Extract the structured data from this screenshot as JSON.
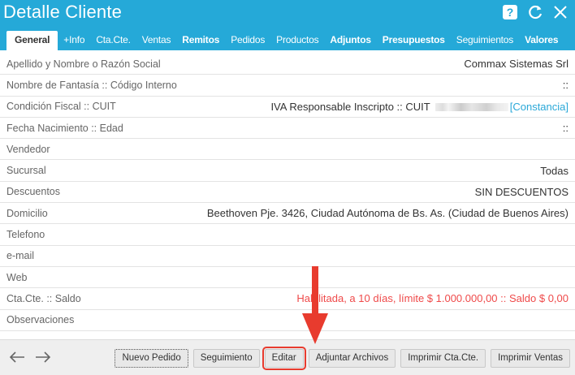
{
  "window": {
    "title": "Detalle Cliente",
    "icons": [
      "help-icon",
      "refresh-icon",
      "close-icon"
    ]
  },
  "tabs": [
    {
      "label": "General",
      "active": true
    },
    {
      "label": "+Info"
    },
    {
      "label": "Cta.Cte."
    },
    {
      "label": "Ventas"
    },
    {
      "label": "Remitos"
    },
    {
      "label": "Pedidos"
    },
    {
      "label": "Productos"
    },
    {
      "label": "Adjuntos"
    },
    {
      "label": "Presupuestos"
    },
    {
      "label": "Seguimientos"
    },
    {
      "label": "Valores"
    }
  ],
  "fields": {
    "razon_social": {
      "label": "Apellido y Nombre o Razón Social",
      "value": "Commax Sistemas Srl"
    },
    "fantasia": {
      "label": "Nombre de Fantasía :: Código Interno",
      "value": "::"
    },
    "condicion": {
      "label": "Condición Fiscal :: CUIT",
      "value": "IVA Responsable Inscripto :: CUIT",
      "link": "[Constancia]"
    },
    "nacimiento": {
      "label": "Fecha Nacimiento :: Edad",
      "value": "::"
    },
    "vendedor": {
      "label": "Vendedor",
      "value": ""
    },
    "sucursal": {
      "label": "Sucursal",
      "value": "Todas"
    },
    "descuentos": {
      "label": "Descuentos",
      "value": "SIN DESCUENTOS"
    },
    "domicilio": {
      "label": "Domicilio",
      "value": "Beethoven Pje. 3426, Ciudad Autónoma de Bs. As. (Ciudad de Buenos Aires)"
    },
    "telefono": {
      "label": "Telefono",
      "value": ""
    },
    "email": {
      "label": "e-mail",
      "value": ""
    },
    "web": {
      "label": "Web",
      "value": ""
    },
    "ctacte": {
      "label": "Cta.Cte. :: Saldo",
      "value": "Habilitada, a 10 días, límite $ 1.000.000,00 :: Saldo $ 0,00"
    },
    "observaciones": {
      "label": "Observaciones",
      "value": ""
    }
  },
  "footer": {
    "buttons": {
      "nuevo_pedido": "Nuevo Pedido",
      "seguimiento": "Seguimiento",
      "editar": "Editar",
      "adjuntar": "Adjuntar Archivos",
      "imprimir_ctacte": "Imprimir Cta.Cte.",
      "imprimir_ventas": "Imprimir Ventas"
    }
  },
  "colors": {
    "header": "#25a9d8",
    "link": "#2aa8d8",
    "alert_text": "#ef4a4a",
    "annotation": "#e83b2e"
  }
}
